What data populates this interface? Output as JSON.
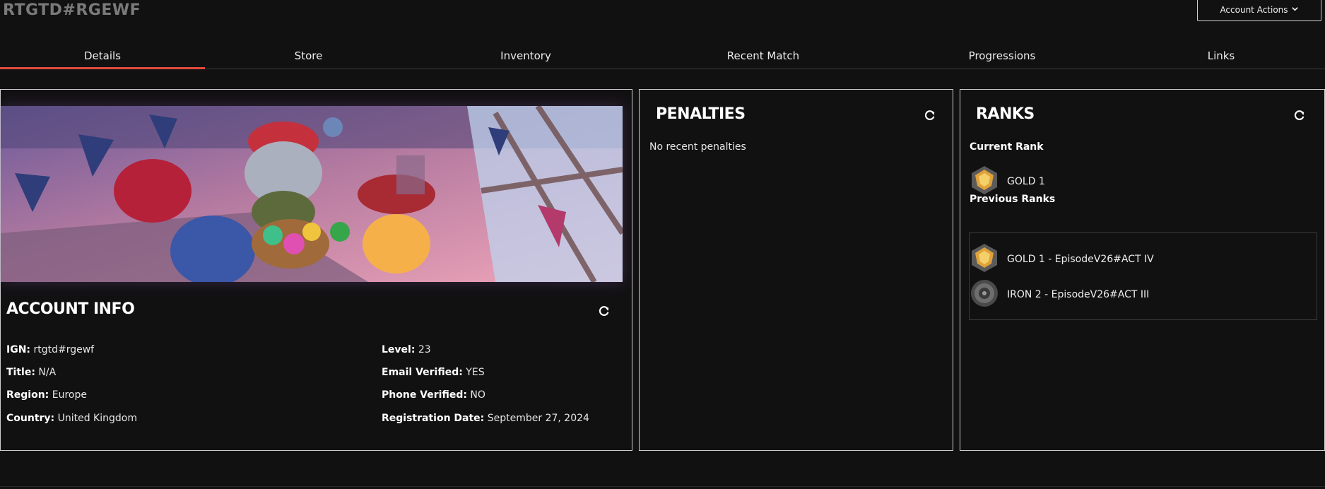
{
  "header": {
    "logo": "RTGTD#RGEWF",
    "account_actions_label": "Account Actions"
  },
  "tabs": [
    {
      "label": "Details",
      "active": true
    },
    {
      "label": "Store",
      "active": false
    },
    {
      "label": "Inventory",
      "active": false
    },
    {
      "label": "Recent Match",
      "active": false
    },
    {
      "label": "Progressions",
      "active": false
    },
    {
      "label": "Links",
      "active": false
    }
  ],
  "account_info": {
    "title": "ACCOUNT INFO",
    "left": [
      {
        "label": "IGN:",
        "value": "rtgtd#rgewf"
      },
      {
        "label": "Title:",
        "value": "N/A"
      },
      {
        "label": "Region:",
        "value": "Europe"
      },
      {
        "label": "Country:",
        "value": "United Kingdom"
      }
    ],
    "right": [
      {
        "label": "Level:",
        "value": "23"
      },
      {
        "label": "Email Verified:",
        "value": "YES"
      },
      {
        "label": "Phone Verified:",
        "value": "NO"
      },
      {
        "label": "Registration Date:",
        "value": "September 27, 2024"
      }
    ]
  },
  "penalties": {
    "title": "PENALTIES",
    "message": "No recent penalties"
  },
  "ranks": {
    "title": "RANKS",
    "current_heading": "Current Rank",
    "current": {
      "label": "GOLD 1",
      "icon": "gold-rank-icon"
    },
    "previous_heading": "Previous Ranks",
    "previous": [
      {
        "label": "GOLD 1 - EpisodeV26#ACT IV",
        "icon": "gold-rank-icon"
      },
      {
        "label": "IRON 2 - EpisodeV26#ACT III",
        "icon": "iron-rank-icon"
      }
    ]
  },
  "colors": {
    "background": "#121112",
    "accent": "#e24b3d",
    "border": "#cfcfcf"
  }
}
